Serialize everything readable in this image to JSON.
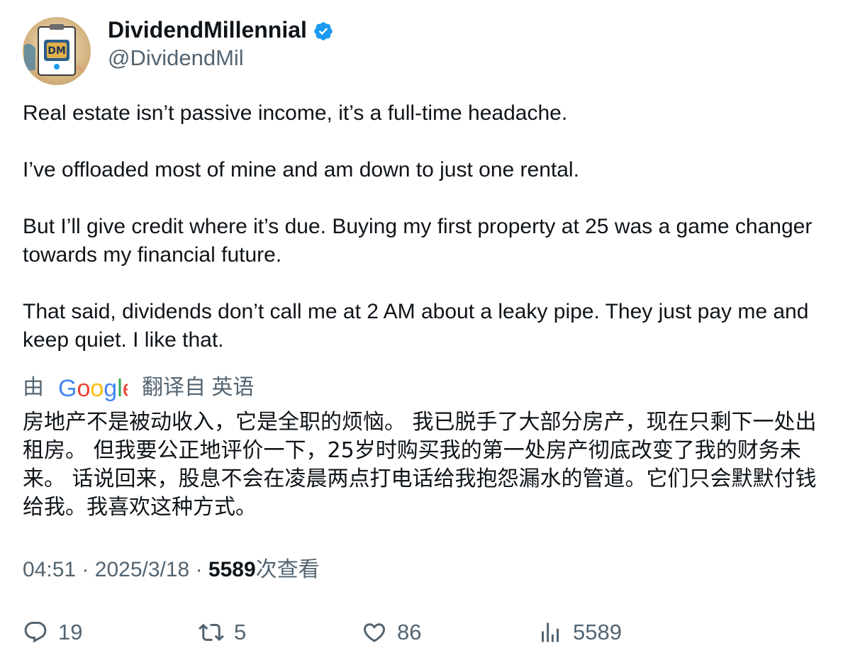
{
  "author": {
    "display_name": "DividendMillennial",
    "handle": "@DividendMil",
    "verified_icon": "verified-badge-icon",
    "avatar_monogram": "DM"
  },
  "tweet": {
    "paragraphs": [
      "Real estate isn’t passive income, it’s a full-time headache.",
      "I’ve offloaded most of mine and am down to just one rental.",
      "But I’ll give credit where it’s due. Buying my first property at 25 was a game changer towards my financial future.",
      "That said, dividends don’t call me at 2 AM about a leaky pipe. They just pay me and keep quiet. I like that."
    ]
  },
  "translation": {
    "prefix": "由",
    "provider": "Google",
    "suffix": "翻译自 英语",
    "text": "房地产不是被动收入，它是全职的烦恼。 我已脱手了大部分房产，现在只剩下一处出租房。 但我要公正地评价一下，25岁时购买我的第一处房产彻底改变了我的财务未来。 话说回来，股息不会在凌晨两点打电话给我抱怨漏水的管道。它们只会默默付钱给我。我喜欢这种方式。"
  },
  "meta": {
    "time": "04:51",
    "separator": "·",
    "date": "2025/3/18",
    "views": "5589",
    "views_label": "次查看"
  },
  "actions": {
    "replies": "19",
    "retweets": "5",
    "likes": "86",
    "views": "5589"
  },
  "colors": {
    "text": "#0f1419",
    "secondary": "#536471",
    "verified": "#1d9bf0"
  }
}
